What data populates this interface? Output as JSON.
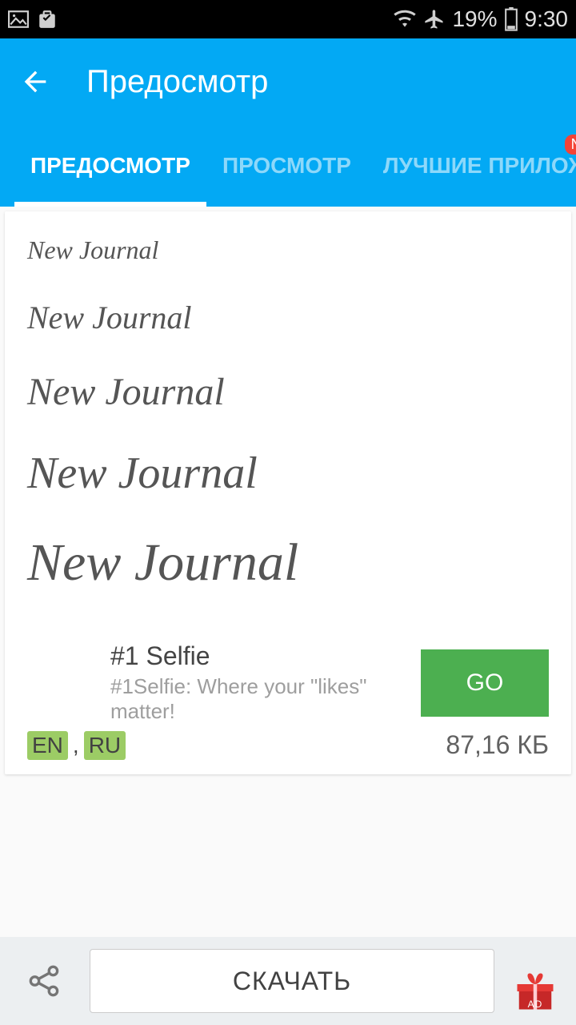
{
  "status": {
    "battery": "19%",
    "time": "9:30"
  },
  "header": {
    "title": "Предосмотр"
  },
  "tabs": [
    {
      "label": "ПРЕДОСМОТР",
      "active": true
    },
    {
      "label": "ПРОСМОТР",
      "active": false
    },
    {
      "label": "ЛУЧШИЕ ПРИЛОЖ",
      "active": false,
      "badge": "New"
    }
  ],
  "preview": {
    "sample_text": "New Journal"
  },
  "ad": {
    "title": "#1 Selfie",
    "subtitle": "#1Selfie: Where your \"likes\" matter!",
    "cta": "GO"
  },
  "meta": {
    "languages": [
      "EN",
      "RU"
    ],
    "separator": ",",
    "file_size": "87,16 КБ"
  },
  "bottom": {
    "download_label": "СКАЧАТЬ",
    "gift_label": "AD"
  }
}
